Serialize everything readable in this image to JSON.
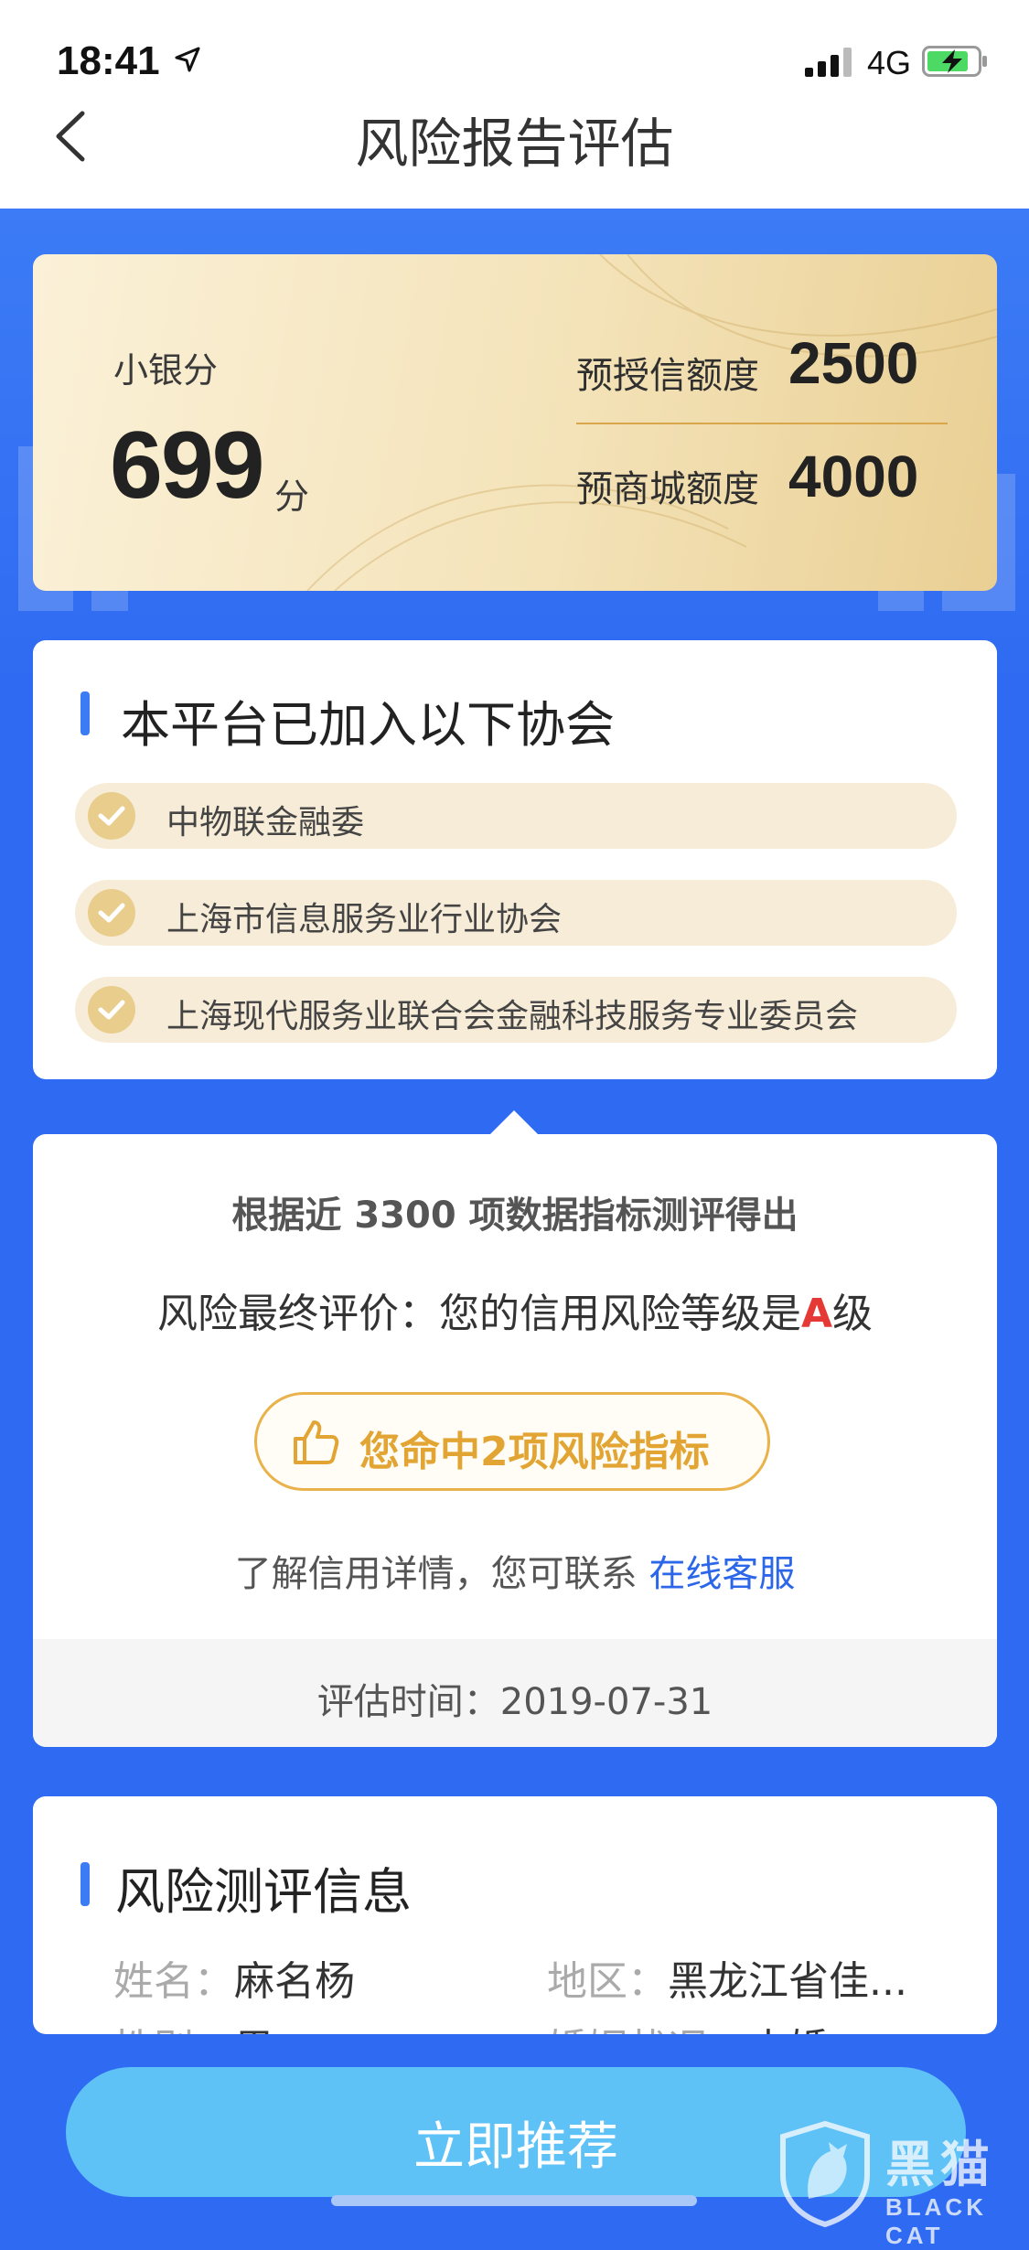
{
  "status": {
    "time": "18:41",
    "network": "4G"
  },
  "nav": {
    "title": "风险报告评估"
  },
  "score": {
    "label": "小银分",
    "value": "699",
    "unit": "分",
    "credit_label": "预授信额度",
    "credit_value": "2500",
    "mall_label": "预商城额度",
    "mall_value": "4000"
  },
  "associations": {
    "title": "本平台已加入以下协会",
    "items": [
      "中物联金融委",
      "上海市信息服务业行业协会",
      "上海现代服务业联合会金融科技服务专业委员会"
    ]
  },
  "result": {
    "subtitle": "根据近 3300 项数据指标测评得出",
    "final_prefix": "风险最终评价：您的信用风险等级是",
    "grade": "A",
    "final_suffix": "级",
    "hit_button": "您命中2项风险指标",
    "contact_prefix": "了解信用详情，您可联系 ",
    "contact_link": "在线客服",
    "eval_time": "评估时间：2019-07-31"
  },
  "info": {
    "title": "风险测评信息",
    "name_key": "姓名：",
    "name_val": "麻名杨",
    "region_key": "地区：",
    "region_val": "黑龙江省佳...",
    "gender_key": "性别：",
    "gender_val": "男",
    "marital_key": "婚姻状况：",
    "marital_val": "未婚"
  },
  "cta": {
    "label": "立即推荐"
  },
  "watermark": {
    "cn": "黑猫",
    "en": "BLACK CAT"
  },
  "colors": {
    "accent": "#3b7bf4",
    "gold": "#e2a534",
    "grade_red": "#e53935",
    "link": "#2b67e8"
  }
}
